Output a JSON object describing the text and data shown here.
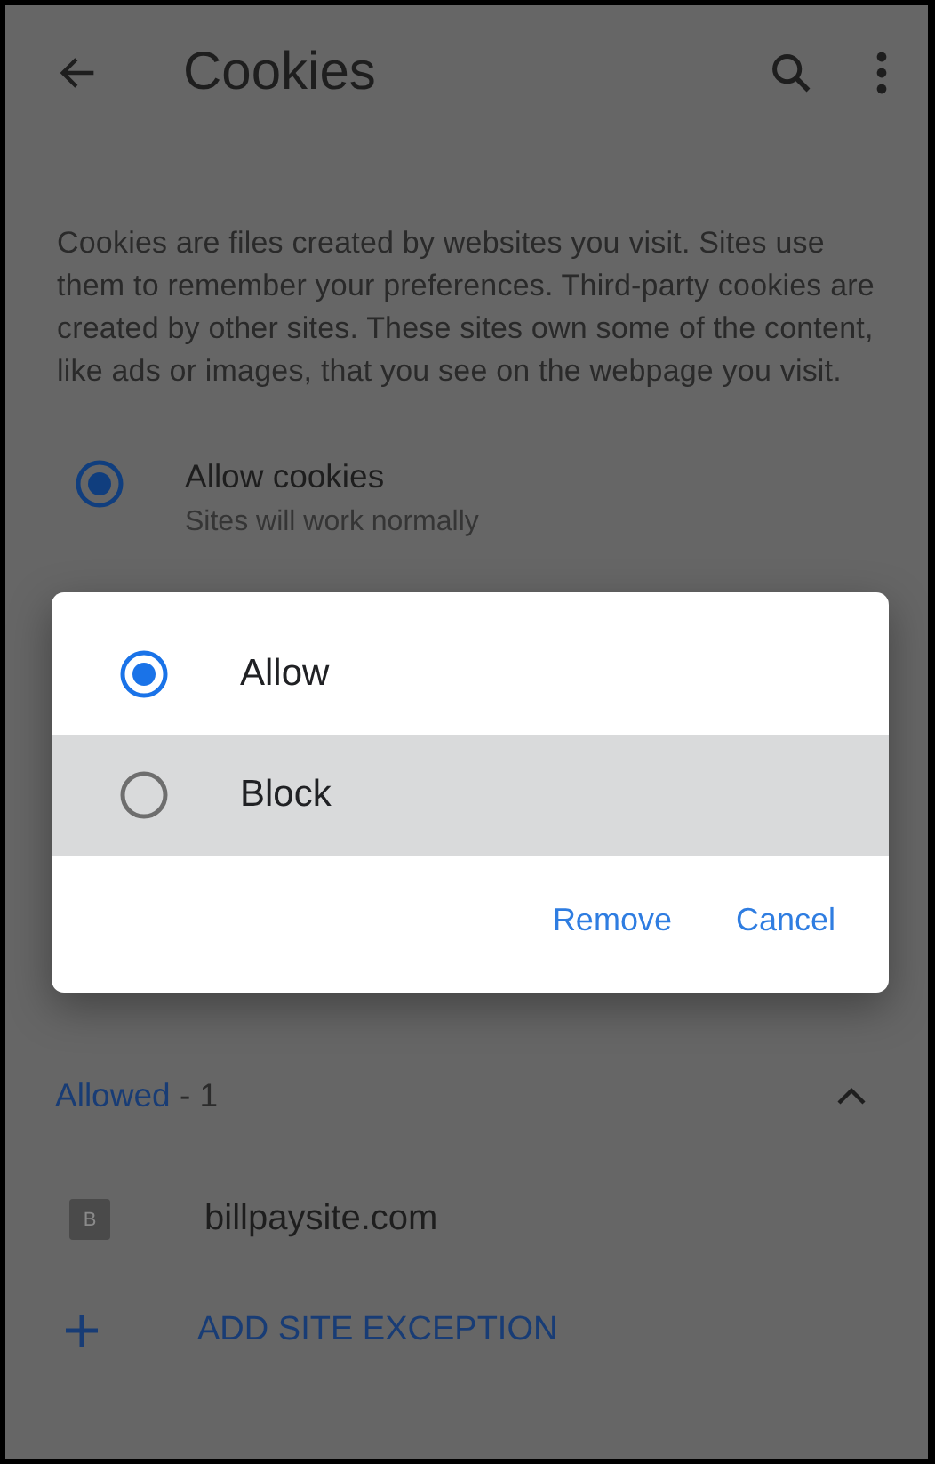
{
  "toolbar": {
    "title": "Cookies"
  },
  "description": "Cookies are files created by websites you visit. Sites use them to remember your preferences. Third-party cookies are created by other sites. These sites own some of the content, like ads or images, that you see on the webpage you visit.",
  "cookie_option": {
    "label": "Allow cookies",
    "sublabel": "Sites will work normally",
    "selected": true
  },
  "dialog": {
    "options": [
      {
        "label": "Allow",
        "selected": true,
        "focused": false
      },
      {
        "label": "Block",
        "selected": false,
        "focused": true
      }
    ],
    "buttons": [
      "Remove",
      "Cancel"
    ]
  },
  "allowed_section": {
    "label": "Allowed",
    "count": "- 1",
    "expanded": true
  },
  "sites": [
    {
      "initial": "B",
      "name": "billpaysite.com"
    }
  ],
  "add_exception": "ADD SITE EXCEPTION"
}
